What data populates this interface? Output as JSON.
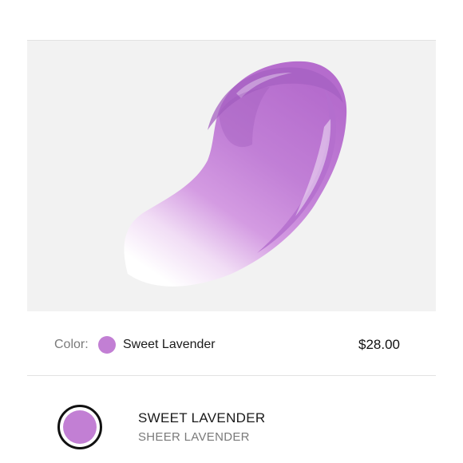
{
  "product": {
    "color_label": "Color:",
    "color_name": "Sweet Lavender",
    "price": "$28.00",
    "swatch_color": "#c27fd4"
  },
  "shade": {
    "name": "SWEET LAVENDER",
    "description": "SHEER LAVENDER",
    "color": "#c27fd4"
  },
  "colors": {
    "panel_bg": "#f2f2f2",
    "lavender_dark": "#a15bbd",
    "lavender_mid": "#c17fd6",
    "lavender_light": "#e9c8f1"
  }
}
